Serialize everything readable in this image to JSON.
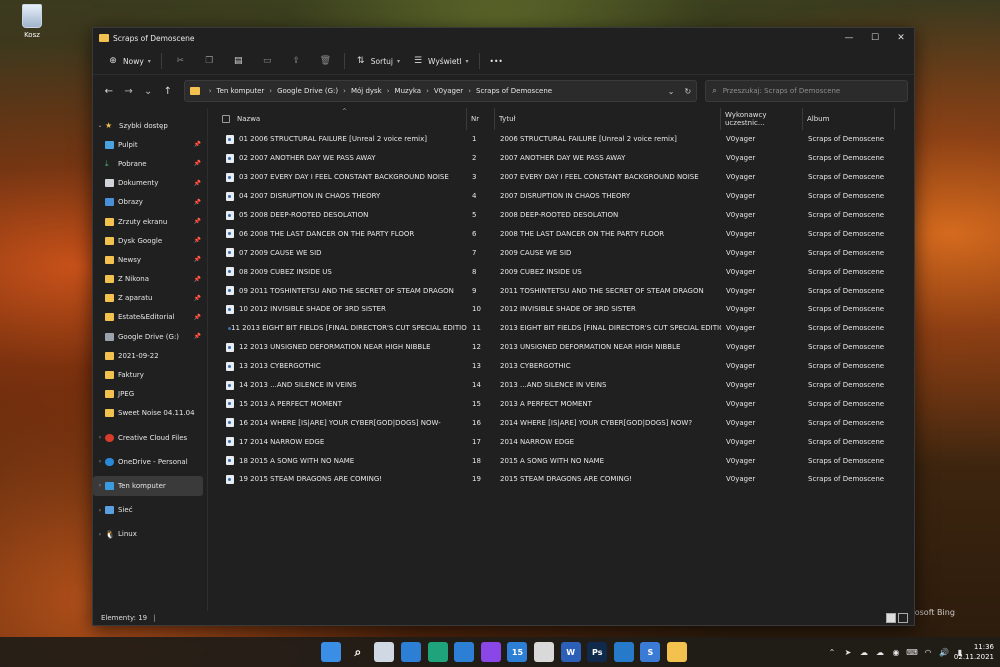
{
  "desktop": {
    "recycle_label": "Kosz",
    "bing_text": "icrosoft Bing"
  },
  "window": {
    "title": "Scraps of Demoscene"
  },
  "toolbar": {
    "new_label": "Nowy",
    "sort_label": "Sortuj",
    "view_label": "Wyświetl",
    "more_label": "•••"
  },
  "address": {
    "crumbs": [
      "Ten komputer",
      "Google Drive (G:)",
      "Mój dysk",
      "Muzyka",
      "V0yager",
      "Scraps of Demoscene"
    ],
    "search_placeholder": "Przeszukaj: Scraps of Demoscene"
  },
  "sidebar": {
    "items": [
      {
        "label": "Szybki dostęp",
        "icon": "star-icon"
      },
      {
        "label": "Pulpit",
        "icon": "desktop-icon"
      },
      {
        "label": "Pobrane",
        "icon": "download-icon"
      },
      {
        "label": "Dokumenty",
        "icon": "documents-icon"
      },
      {
        "label": "Obrazy",
        "icon": "pictures-icon"
      },
      {
        "label": "Zrzuty ekranu",
        "icon": "folder-icon"
      },
      {
        "label": "Dysk Google",
        "icon": "folder-icon"
      },
      {
        "label": "Newsy",
        "icon": "folder-icon"
      },
      {
        "label": "Z Nikona",
        "icon": "folder-icon"
      },
      {
        "label": "Z aparatu",
        "icon": "folder-icon"
      },
      {
        "label": "Estate&Editorial",
        "icon": "folder-icon"
      },
      {
        "label": "Google Drive (G:)",
        "icon": "drive-icon"
      },
      {
        "label": "2021-09-22",
        "icon": "folder-icon"
      },
      {
        "label": "Faktury",
        "icon": "folder-icon"
      },
      {
        "label": "JPEG",
        "icon": "folder-icon"
      },
      {
        "label": "Sweet Noise 04.11.04",
        "icon": "folder-icon"
      },
      {
        "label": "Creative Cloud Files",
        "icon": "creative-cloud-icon"
      },
      {
        "label": "OneDrive - Personal",
        "icon": "onedrive-icon"
      },
      {
        "label": "Ten komputer",
        "icon": "this-pc-icon"
      },
      {
        "label": "Sieć",
        "icon": "network-icon"
      },
      {
        "label": "Linux",
        "icon": "linux-icon"
      }
    ]
  },
  "columns": {
    "name": "Nazwa",
    "nr": "Nr",
    "title": "Tytuł",
    "artist": "Wykonawcy uczestnic...",
    "album": "Album"
  },
  "files": [
    {
      "name": "01 2006 STRUCTURAL FAILURE [Unreal 2 voice remix]",
      "nr": "1",
      "title": "2006 STRUCTURAL FAILURE [Unreal 2 voice remix]",
      "artist": "V0yager",
      "album": "Scraps of Demoscene"
    },
    {
      "name": "02 2007 ANOTHER DAY WE PASS AWAY",
      "nr": "2",
      "title": "2007 ANOTHER DAY WE PASS AWAY",
      "artist": "V0yager",
      "album": "Scraps of Demoscene"
    },
    {
      "name": "03 2007 EVERY DAY I FEEL CONSTANT BACKGROUND NOISE",
      "nr": "3",
      "title": "2007 EVERY DAY I FEEL CONSTANT BACKGROUND NOISE",
      "artist": "V0yager",
      "album": "Scraps of Demoscene"
    },
    {
      "name": "04 2007 DISRUPTION IN CHAOS THEORY",
      "nr": "4",
      "title": "2007 DISRUPTION IN CHAOS THEORY",
      "artist": "V0yager",
      "album": "Scraps of Demoscene"
    },
    {
      "name": "05 2008 DEEP-ROOTED DESOLATION",
      "nr": "5",
      "title": "2008 DEEP-ROOTED DESOLATION",
      "artist": "V0yager",
      "album": "Scraps of Demoscene"
    },
    {
      "name": "06 2008 THE LAST DANCER ON THE PARTY FLOOR",
      "nr": "6",
      "title": "2008 THE LAST DANCER ON THE PARTY FLOOR",
      "artist": "V0yager",
      "album": "Scraps of Demoscene"
    },
    {
      "name": "07 2009 CAUSE WE SID",
      "nr": "7",
      "title": "2009 CAUSE WE SID",
      "artist": "V0yager",
      "album": "Scraps of Demoscene"
    },
    {
      "name": "08 2009 CUBEZ INSIDE US",
      "nr": "8",
      "title": "2009 CUBEZ INSIDE US",
      "artist": "V0yager",
      "album": "Scraps of Demoscene"
    },
    {
      "name": "09 2011 TOSHINTETSU AND THE SECRET OF STEAM DRAGON",
      "nr": "9",
      "title": "2011 TOSHINTETSU AND THE SECRET OF STEAM DRAGON",
      "artist": "V0yager",
      "album": "Scraps of Demoscene"
    },
    {
      "name": "10 2012 INVISIBLE SHADE OF 3RD SISTER",
      "nr": "10",
      "title": "2012 INVISIBLE SHADE OF 3RD SISTER",
      "artist": "V0yager",
      "album": "Scraps of Demoscene"
    },
    {
      "name": "11 2013 EIGHT BIT FIELDS [FINAL DIRECTOR'S CUT SPECIAL EDITION]",
      "nr": "11",
      "title": "2013 EIGHT BIT FIELDS [FINAL DIRECTOR'S CUT SPECIAL EDITION]",
      "artist": "V0yager",
      "album": "Scraps of Demoscene"
    },
    {
      "name": "12 2013 UNSIGNED DEFORMATION NEAR HIGH NIBBLE",
      "nr": "12",
      "title": "2013 UNSIGNED DEFORMATION NEAR HIGH NIBBLE",
      "artist": "V0yager",
      "album": "Scraps of Demoscene"
    },
    {
      "name": "13 2013 CYBERGOTHIC",
      "nr": "13",
      "title": "2013 CYBERGOTHIC",
      "artist": "V0yager",
      "album": "Scraps of Demoscene"
    },
    {
      "name": "14 2013 ...AND SILENCE IN VEINS",
      "nr": "14",
      "title": "2013 ...AND SILENCE IN VEINS",
      "artist": "V0yager",
      "album": "Scraps of Demoscene"
    },
    {
      "name": "15 2013 A PERFECT MOMENT",
      "nr": "15",
      "title": "2013 A PERFECT MOMENT",
      "artist": "V0yager",
      "album": "Scraps of Demoscene"
    },
    {
      "name": "16 2014 WHERE [IS|ARE] YOUR CYBER[GOD|DOGS] NOW-",
      "nr": "16",
      "title": "2014 WHERE [IS|ARE] YOUR CYBER[GOD|DOGS] NOW?",
      "artist": "V0yager",
      "album": "Scraps of Demoscene"
    },
    {
      "name": "17 2014 NARROW EDGE",
      "nr": "17",
      "title": "2014 NARROW EDGE",
      "artist": "V0yager",
      "album": "Scraps of Demoscene"
    },
    {
      "name": "18 2015 A SONG WITH NO NAME",
      "nr": "18",
      "title": "2015 A SONG WITH NO NAME",
      "artist": "V0yager",
      "album": "Scraps of Demoscene"
    },
    {
      "name": "19 2015 STEAM DRAGONS ARE COMING!",
      "nr": "19",
      "title": "2015 STEAM DRAGONS ARE COMING!",
      "artist": "V0yager",
      "album": "Scraps of Demoscene"
    }
  ],
  "status": {
    "count": "Elementy: 19"
  },
  "taskbar": {
    "apps": [
      {
        "icon": "windows-start-icon",
        "label": "",
        "color": "#3a8ee6"
      },
      {
        "icon": "search-icon",
        "label": "",
        "color": "#ffffff"
      },
      {
        "icon": "task-view-icon",
        "label": "",
        "color": "#cfd8e3"
      },
      {
        "icon": "widgets-icon",
        "label": "",
        "color": "#2d7fd6"
      },
      {
        "icon": "edge-icon",
        "label": "",
        "color": "#1fa37a"
      },
      {
        "icon": "mail-icon",
        "label": "",
        "color": "#2d7fd6"
      },
      {
        "icon": "messenger-icon",
        "label": "",
        "color": "#8a46e6"
      },
      {
        "icon": "calendar-icon",
        "label": "15",
        "color": "#2d7fd6"
      },
      {
        "icon": "slack-icon",
        "label": "",
        "color": "#d9d9d9"
      },
      {
        "icon": "word-icon",
        "label": "W",
        "color": "#2b5fb8"
      },
      {
        "icon": "photoshop-icon",
        "label": "Ps",
        "color": "#0f2a4a"
      },
      {
        "icon": "trello-icon",
        "label": "",
        "color": "#2779c9"
      },
      {
        "icon": "skype-icon",
        "label": "S",
        "color": "#3a7bd5"
      },
      {
        "icon": "file-explorer-icon",
        "label": "",
        "color": "#f2c14e"
      }
    ],
    "tray": [
      "chevron-up-icon",
      "telegram-icon",
      "onedrive-icon",
      "cloud-icon",
      "steam-icon",
      "keyboard-icon",
      "wifi-icon",
      "volume-icon",
      "battery-icon"
    ],
    "time": "11:36",
    "date": "02.11.2021"
  }
}
